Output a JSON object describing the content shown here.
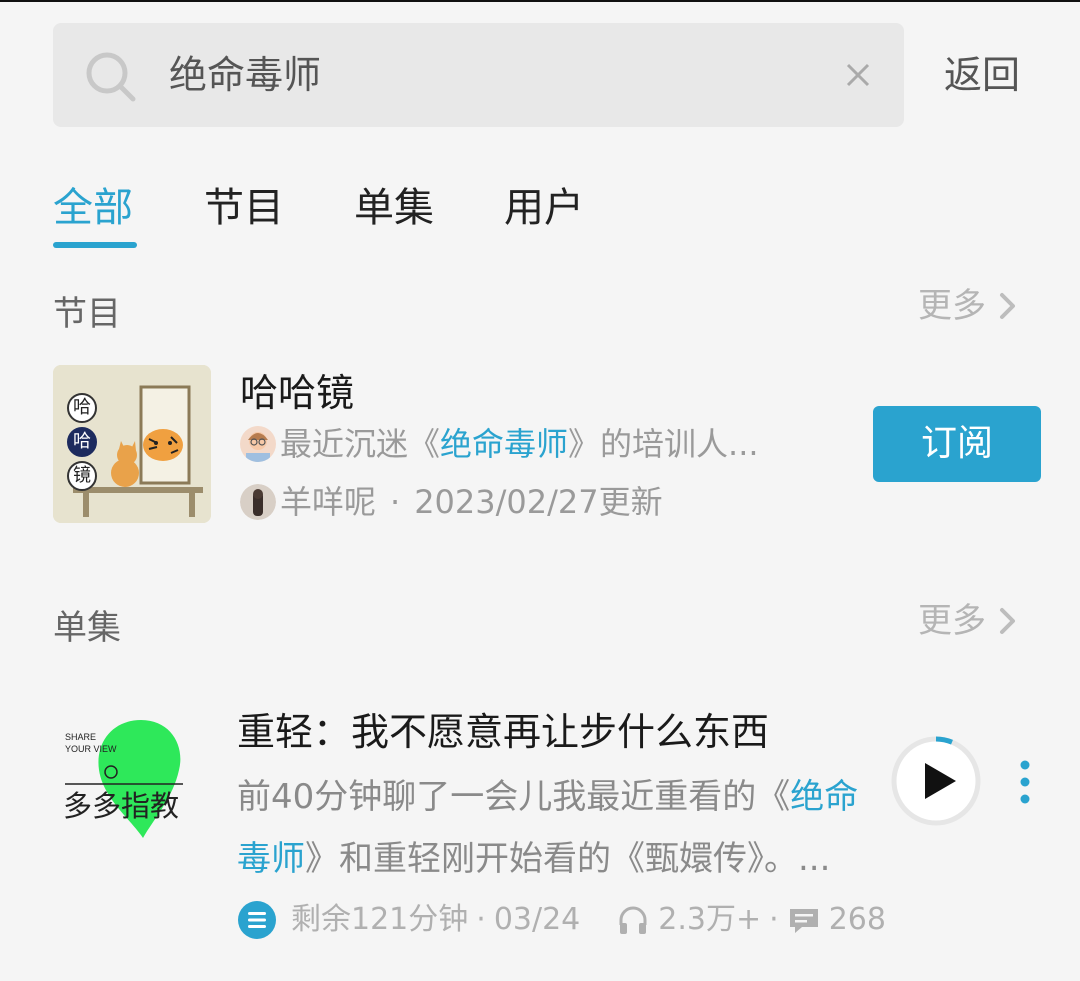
{
  "search": {
    "query": "绝命毒师",
    "back_label": "返回"
  },
  "tabs": [
    {
      "label": "全部",
      "active": true
    },
    {
      "label": "节目",
      "active": false
    },
    {
      "label": "单集",
      "active": false
    },
    {
      "label": "用户",
      "active": false
    }
  ],
  "programs_section": {
    "title": "节目",
    "more_label": "更多",
    "item": {
      "cover_text": [
        "哈",
        "哈",
        "镜"
      ],
      "title": "哈哈镜",
      "desc_prefix": "最近沉迷《",
      "desc_highlight": "绝命毒师",
      "desc_suffix": "》的培训人...",
      "author": "羊咩呢",
      "updated": "2023/02/27更新",
      "subscribe_label": "订阅"
    }
  },
  "episodes_section": {
    "title": "单集",
    "more_label": "更多",
    "item": {
      "cover_small_text_1": "SHARE",
      "cover_small_text_2": "YOUR VIEW",
      "cover_text": "多多指教",
      "title": "重轻：我不愿意再让步什么东西",
      "desc_part1": "前40分钟聊了一会儿我最近重看的《",
      "desc_highlight": "绝命毒师",
      "desc_part2": "》和重轻刚开始看的《甄嬛传》。...",
      "remaining": "剩余121分钟",
      "date": "03/24",
      "plays": "2.3万+",
      "comments": "268"
    }
  },
  "colors": {
    "accent": "#2aa3cf",
    "cover_green": "#2ee85a"
  }
}
